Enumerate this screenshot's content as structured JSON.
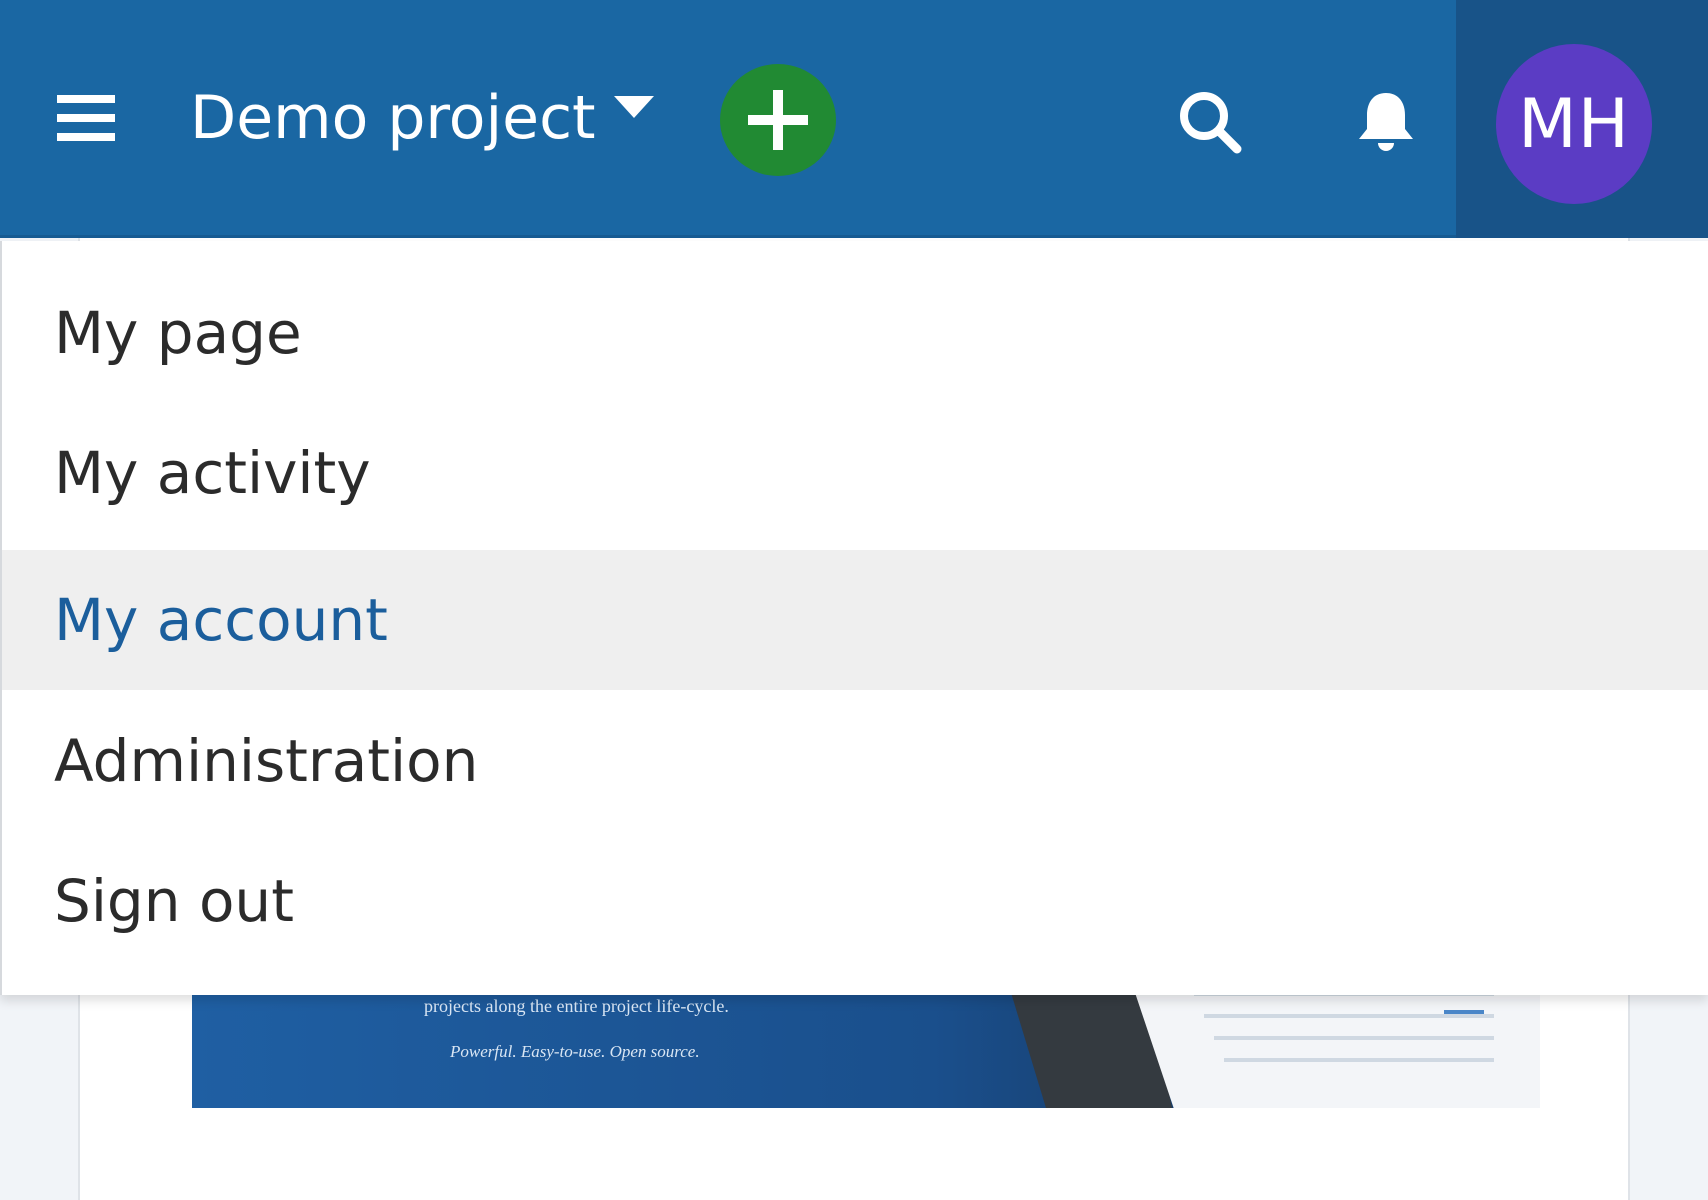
{
  "header": {
    "project_name": "Demo project",
    "user_initials": "MH",
    "icons": {
      "menu": "hamburger-icon",
      "project_caret": "caret-down-icon",
      "add": "plus-icon",
      "search": "search-icon",
      "notifications": "bell-icon"
    },
    "colors": {
      "header_bg": "#1a67a3",
      "add_button": "#218a33",
      "avatar": "#5b3cc4"
    }
  },
  "user_menu": {
    "items": [
      {
        "label": "My page"
      },
      {
        "label": "My activity"
      },
      {
        "label": "My account",
        "state": "hovered"
      },
      {
        "label": "Administration"
      },
      {
        "label": "Sign out"
      }
    ],
    "colors": {
      "hover_bg": "#efefef",
      "hover_text": "#1b5e9c"
    }
  },
  "background": {
    "banner_line_1": "projects along the entire project life-cycle.",
    "banner_line_2": "Powerful. Easy-to-use. Open source."
  }
}
